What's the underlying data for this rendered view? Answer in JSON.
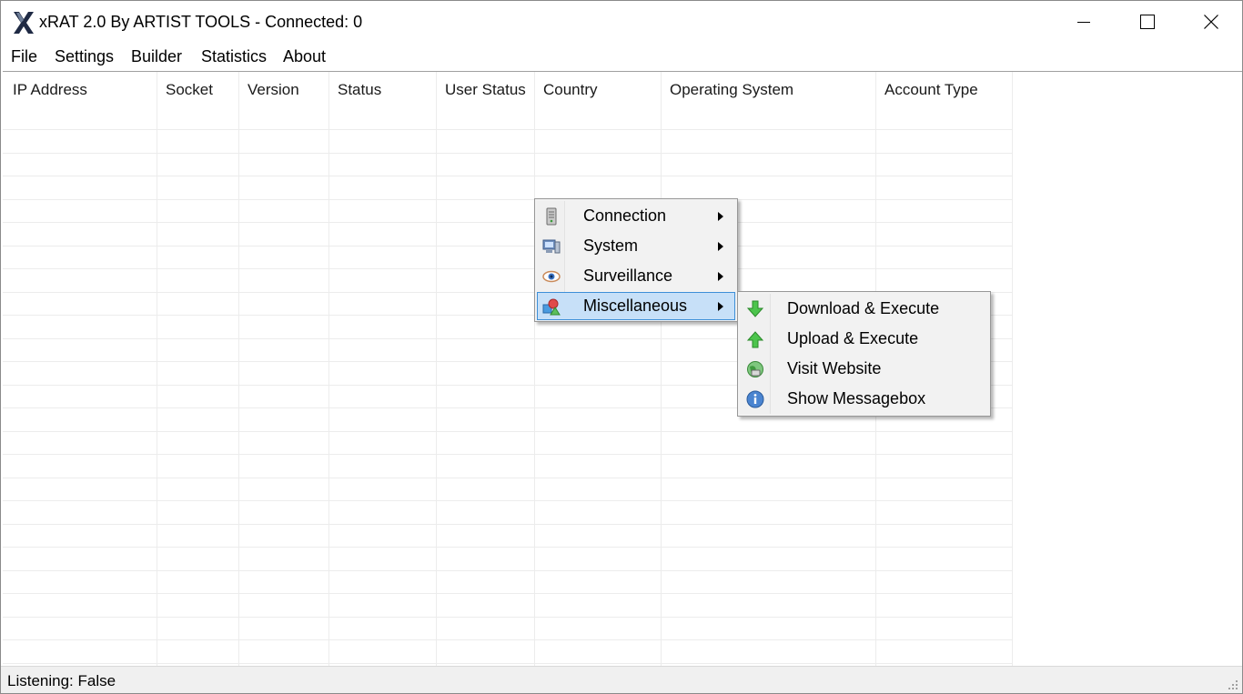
{
  "window": {
    "title": "xRAT 2.0 By ARTIST TOOLS - Connected: 0",
    "icons": {
      "app": "x-logo-icon",
      "minimize": "minimize-icon",
      "maximize": "maximize-icon",
      "close": "close-icon"
    }
  },
  "menubar": {
    "items": [
      {
        "label": "File"
      },
      {
        "label": "Settings"
      },
      {
        "label": "Builder"
      },
      {
        "label": "Statistics"
      },
      {
        "label": "About"
      }
    ]
  },
  "listview": {
    "columns": [
      {
        "label": "IP Address"
      },
      {
        "label": "Socket"
      },
      {
        "label": "Version"
      },
      {
        "label": "Status"
      },
      {
        "label": "User Status"
      },
      {
        "label": "Country"
      },
      {
        "label": "Operating System"
      },
      {
        "label": "Account Type"
      }
    ],
    "rows": []
  },
  "context_menu": {
    "items": [
      {
        "label": "Connection",
        "icon": "server-icon",
        "has_submenu": true
      },
      {
        "label": "System",
        "icon": "computer-icon",
        "has_submenu": true
      },
      {
        "label": "Surveillance",
        "icon": "eye-icon",
        "has_submenu": true
      },
      {
        "label": "Miscellaneous",
        "icon": "misc-shapes-icon",
        "has_submenu": true,
        "highlighted": true
      }
    ],
    "submenu": {
      "items": [
        {
          "label": "Download & Execute",
          "icon": "download-arrow-icon"
        },
        {
          "label": "Upload & Execute",
          "icon": "upload-arrow-icon"
        },
        {
          "label": "Visit Website",
          "icon": "globe-icon"
        },
        {
          "label": "Show Messagebox",
          "icon": "info-icon"
        }
      ]
    }
  },
  "statusbar": {
    "text": "Listening: False"
  },
  "colors": {
    "highlight_bg": "#c7e0f8",
    "highlight_border": "#3d8fd8",
    "menu_bg": "#f2f2f2"
  }
}
